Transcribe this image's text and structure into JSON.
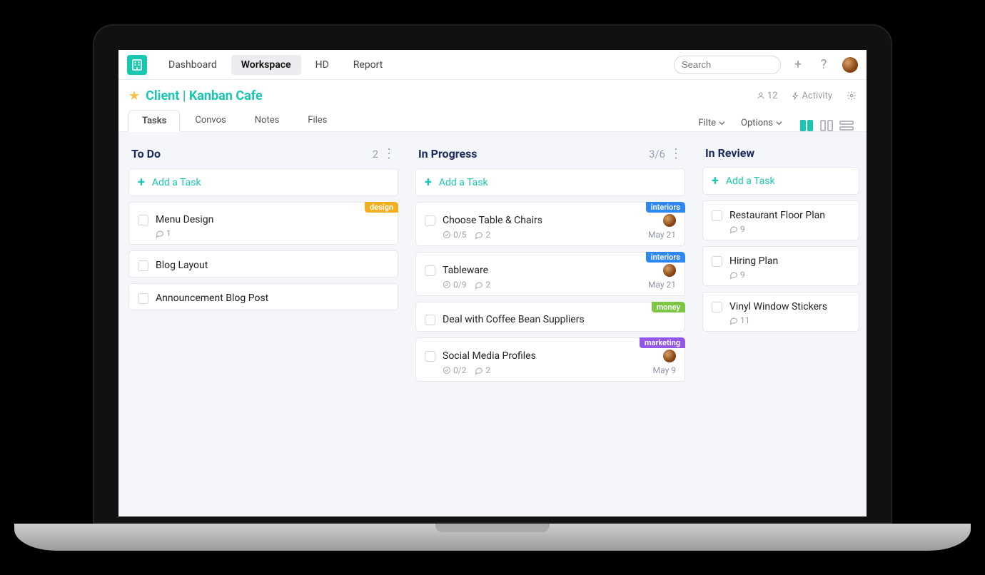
{
  "nav": {
    "items": [
      "Dashboard",
      "Workspace",
      "HD",
      "Report"
    ],
    "active_index": 1
  },
  "search": {
    "placeholder": "Search"
  },
  "project": {
    "title": "Client | Kanban Cafe",
    "members": "12",
    "activity": "Activity"
  },
  "tabs": {
    "items": [
      "Tasks",
      "Convos",
      "Notes",
      "Files"
    ],
    "active_index": 0,
    "filter": "Filte",
    "options": "Options"
  },
  "add_task_label": "Add a Task",
  "columns": [
    {
      "title": "To Do",
      "count": "2",
      "cards": [
        {
          "title": "Menu Design",
          "tag": "design",
          "comments": "1"
        },
        {
          "title": "Blog Layout"
        },
        {
          "title": "Announcement Blog Post"
        }
      ]
    },
    {
      "title": "In Progress",
      "count": "3/6",
      "cards": [
        {
          "title": "Choose Table & Chairs",
          "tag": "interiors",
          "subtasks": "0/5",
          "comments": "2",
          "date": "May 21",
          "avatar": true
        },
        {
          "title": "Tableware",
          "tag": "interiors",
          "subtasks": "0/9",
          "comments": "2",
          "date": "May 21",
          "avatar": true
        },
        {
          "title": "Deal with Coffee Bean Suppliers",
          "tag": "money"
        },
        {
          "title": "Social Media Profiles",
          "tag": "marketing",
          "subtasks": "0/2",
          "comments": "2",
          "date": "May 9",
          "avatar": true
        }
      ]
    },
    {
      "title": "In Review",
      "count": "",
      "cards": [
        {
          "title": "Restaurant Floor Plan",
          "comments": "9"
        },
        {
          "title": "Hiring Plan",
          "comments": "9"
        },
        {
          "title": "Vinyl Window Stickers",
          "comments": "11"
        }
      ]
    }
  ],
  "tag_labels": {
    "design": "design",
    "interiors": "interiors",
    "money": "money",
    "marketing": "marketing"
  }
}
